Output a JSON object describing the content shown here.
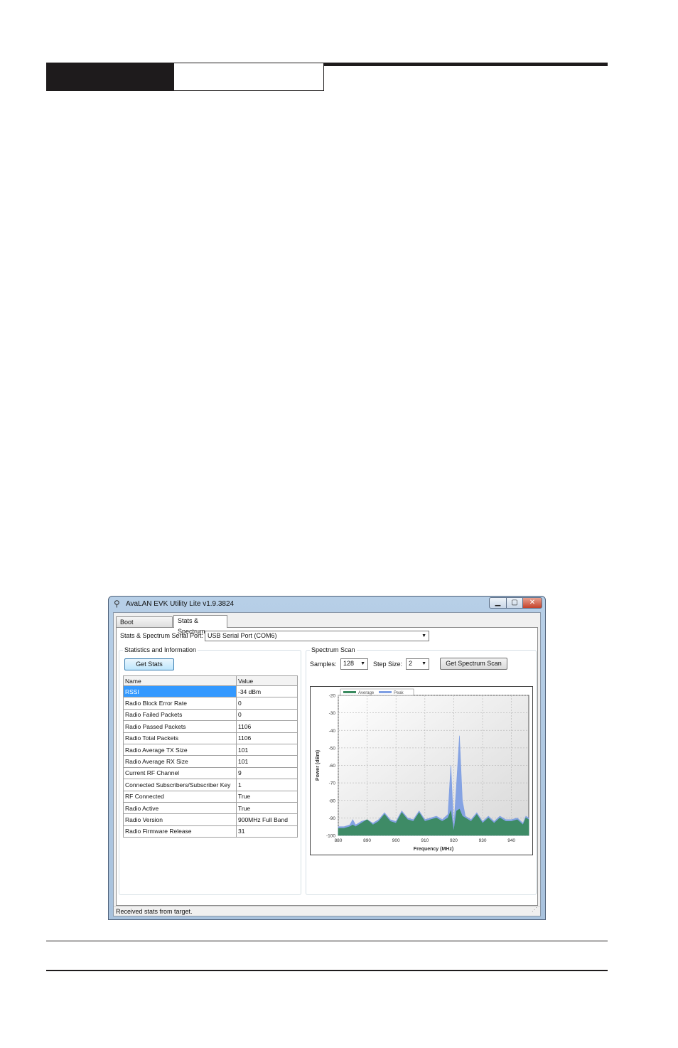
{
  "window": {
    "title": "AvaLAN EVK Utility Lite v1.9.3824",
    "minimize_icon": "minimize-icon",
    "maximize_icon": "maximize-icon",
    "close_icon": "close-icon",
    "min_glyph": "▁",
    "max_glyph": "▢",
    "close_glyph": "✕",
    "app_glyph": "⚲"
  },
  "tabs": [
    {
      "label": "Boot Configuration"
    },
    {
      "label": "Stats & Spectrum"
    }
  ],
  "serial_port": {
    "label": "Stats & Spectrum Serial Port:",
    "value": "USB Serial Port (COM6)"
  },
  "stats": {
    "group_title": "Statistics and Information",
    "button_label": "Get Stats",
    "columns": [
      "Name",
      "Value"
    ],
    "rows": [
      {
        "name": "RSSI",
        "value": "-34 dBm"
      },
      {
        "name": "Radio Block Error Rate",
        "value": "0"
      },
      {
        "name": "Radio Failed Packets",
        "value": "0"
      },
      {
        "name": "Radio Passed Packets",
        "value": "1106"
      },
      {
        "name": "Radio Total Packets",
        "value": "1106"
      },
      {
        "name": "Radio Average TX Size",
        "value": "101"
      },
      {
        "name": "Radio Average RX Size",
        "value": "101"
      },
      {
        "name": "Current RF Channel",
        "value": "9"
      },
      {
        "name": "Connected Subscribers/Subscriber Key",
        "value": "1"
      },
      {
        "name": "RF Connected",
        "value": "True"
      },
      {
        "name": "Radio Active",
        "value": "True"
      },
      {
        "name": "Radio Version",
        "value": "900MHz Full Band"
      },
      {
        "name": "Radio Firmware Release",
        "value": "31"
      }
    ]
  },
  "spectrum": {
    "group_title": "Spectrum Scan",
    "samples_label": "Samples:",
    "samples_value": "128",
    "step_label": "Step Size:",
    "step_value": "2",
    "button_label": "Get Spectrum Scan"
  },
  "status_bar": {
    "text": "Received stats from target."
  },
  "chart_data": {
    "type": "area",
    "xlabel": "Frequency (MHz)",
    "ylabel": "Power (dBm)",
    "xlim": [
      880,
      946
    ],
    "ylim": [
      -100,
      -20
    ],
    "xticks": [
      880,
      890,
      900,
      910,
      920,
      930,
      940
    ],
    "yticks": [
      -20,
      -30,
      -40,
      -50,
      -60,
      -70,
      -80,
      -90,
      -100
    ],
    "grid": true,
    "legend_position": "top-left",
    "x": [
      880,
      882,
      884,
      885,
      886,
      888,
      890,
      892,
      894,
      896,
      898,
      900,
      902,
      904,
      906,
      908,
      910,
      912,
      914,
      916,
      918,
      919,
      920,
      921,
      922,
      923,
      924,
      926,
      928,
      930,
      932,
      934,
      936,
      938,
      940,
      942,
      944,
      945,
      946
    ],
    "series": [
      {
        "name": "Average",
        "color": "#3a8a5f",
        "values": [
          -96,
          -96,
          -95,
          -94,
          -95,
          -93,
          -91,
          -94,
          -92,
          -88,
          -92,
          -93,
          -87,
          -91,
          -92,
          -87,
          -92,
          -91,
          -90,
          -92,
          -90,
          -86,
          -98,
          -86,
          -85,
          -89,
          -90,
          -92,
          -88,
          -93,
          -90,
          -93,
          -90,
          -92,
          -92,
          -91,
          -94,
          -90,
          -91
        ]
      },
      {
        "name": "Peak",
        "color": "#7f9fe3",
        "values": [
          -95,
          -95,
          -94,
          -91,
          -94,
          -92,
          -91,
          -93,
          -91,
          -87,
          -91,
          -92,
          -86,
          -90,
          -91,
          -86,
          -91,
          -90,
          -89,
          -91,
          -88,
          -60,
          -96,
          -70,
          -43,
          -80,
          -89,
          -91,
          -87,
          -92,
          -89,
          -92,
          -89,
          -91,
          -91,
          -90,
          -93,
          -89,
          -90
        ]
      }
    ]
  }
}
